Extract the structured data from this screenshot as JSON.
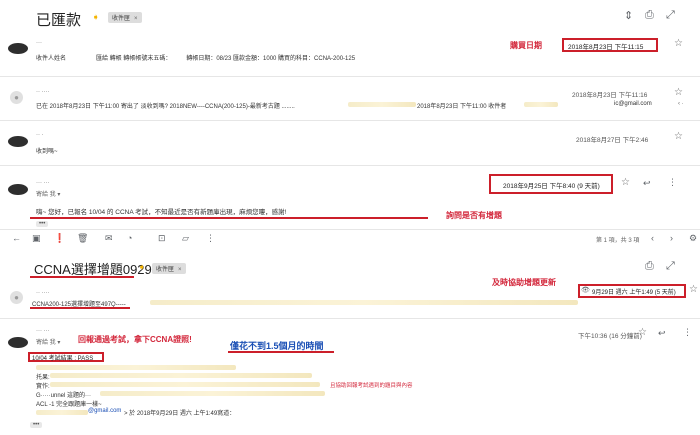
{
  "thread1": {
    "subject": "已匯款",
    "label": "收件匣",
    "label_close": "×",
    "messages": [
      {
        "sender": "···",
        "recipient_line": "收件人姓名　　　　　匯給 轉帳 轉帳帳號末五碼：　　　轉帳日期：08/23 匯款金額：1000 購買的科目：CCNA-200-125",
        "date": "2018年8月23日 下午11:15"
      },
      {
        "sender": "·· ····",
        "snippet_left": "已在 2018年8月23日 下午11:00 寄出了 淡收到嗎? 2018NEW----CCNA(200-125)-最新考古題 ........",
        "snippet_right": "2018年8月23日 下午11:00 收件者",
        "email_fragment": "ic@gmail.com",
        "date": "2018年8月23日 下午11:16"
      },
      {
        "sender": "·· ·",
        "snippet": "收到嗎~",
        "date": "2018年8月27日 下午2:46"
      },
      {
        "sender": "··· ···",
        "to_line": "寄給 我 ▾",
        "body": "嗨~ 您好，已報名 10/04 的 CCNA 考試，不知最近是否有新題庫出現，麻煩您嘍，感謝!",
        "date": "2018年9月25日 下午8:40 (9 天前)"
      }
    ],
    "ellipsis": "•••"
  },
  "toolbar": {
    "pagination": "第 1 項，共 3 項"
  },
  "thread2": {
    "subject": "CCNA選擇增題0929",
    "label": "收件匣",
    "label_close": "×",
    "messages": [
      {
        "sender": "·· ····",
        "body": "CCNA200-125選擇增題至497Q-----",
        "date": "9月29日 週六 上午1:49 (5 天前)"
      },
      {
        "sender": "··· ···",
        "to_line": "寄給 我 ▾",
        "date": "下午10:36 (16 分鐘前)",
        "line1": "10/04 考試結果 : PASS",
        "line2_label": "托果:",
        "line3_label": "實作:",
        "line4": "G·····unnel 這題的···",
        "line5": "ACL -1 完全跟題庫一樣~",
        "quote_email": "@gmail.com",
        "quote_rest": "> 於 2018年9月29日 週六 上午1:49寫道：",
        "ellipsis": "•••"
      }
    ]
  },
  "annotations": {
    "purchase_date": "購買日期",
    "ask_new": "詢問是否有增題",
    "timely_update": "及時協助增題更新",
    "pass_report": "回報通過考試，拿下CCNA證照!",
    "duration": "僅花不到1.5個月的時間",
    "assist_note": "且協助回報考試遇到的題目與內容"
  },
  "icons": [
    "important-marker-icon",
    "sort-icon",
    "print-icon",
    "new-window-icon",
    "star-icon",
    "reply-icon",
    "more-icon",
    "attachment-icon"
  ],
  "colors": {
    "annotation_red": "#d3283c",
    "annotation_blue": "#1a4fb5",
    "important_yellow": "#f4b400"
  }
}
